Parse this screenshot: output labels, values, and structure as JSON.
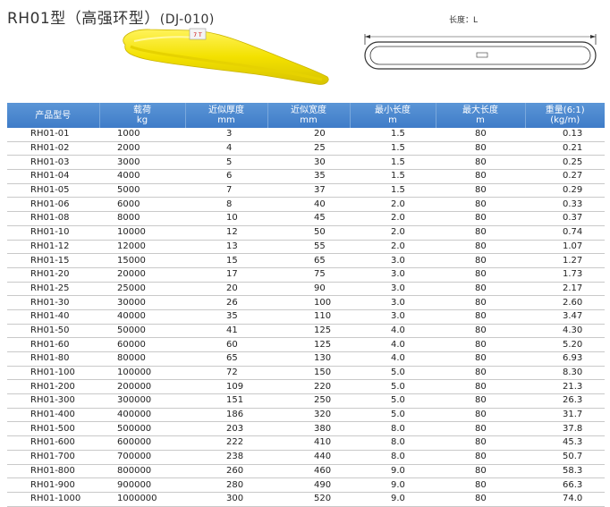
{
  "title": {
    "main": "RH01型（高强环型）",
    "code": "(DJ-010)"
  },
  "photo": {
    "tag_text": "7 T",
    "sling_color": "#f5e400"
  },
  "diagram": {
    "length_label": "长度：L"
  },
  "table": {
    "header_color": "#4a86cf",
    "headers": [
      {
        "l1": "产品型号",
        "l2": ""
      },
      {
        "l1": "载荷",
        "l2": "kg"
      },
      {
        "l1": "近似厚度",
        "l2": "mm"
      },
      {
        "l1": "近似宽度",
        "l2": "mm"
      },
      {
        "l1": "最小长度",
        "l2": "m"
      },
      {
        "l1": "最大长度",
        "l2": "m"
      },
      {
        "l1": "重量(6:1)",
        "l2": "(kg/m)"
      }
    ],
    "rows": [
      [
        "RH01-01",
        "1000",
        "3",
        "20",
        "1.5",
        "80",
        "0.13"
      ],
      [
        "RH01-02",
        "2000",
        "4",
        "25",
        "1.5",
        "80",
        "0.21"
      ],
      [
        "RH01-03",
        "3000",
        "5",
        "30",
        "1.5",
        "80",
        "0.25"
      ],
      [
        "RH01-04",
        "4000",
        "6",
        "35",
        "1.5",
        "80",
        "0.27"
      ],
      [
        "RH01-05",
        "5000",
        "7",
        "37",
        "1.5",
        "80",
        "0.29"
      ],
      [
        "RH01-06",
        "6000",
        "8",
        "40",
        "2.0",
        "80",
        "0.33"
      ],
      [
        "RH01-08",
        "8000",
        "10",
        "45",
        "2.0",
        "80",
        "0.37"
      ],
      [
        "RH01-10",
        "10000",
        "12",
        "50",
        "2.0",
        "80",
        "0.74"
      ],
      [
        "RH01-12",
        "12000",
        "13",
        "55",
        "2.0",
        "80",
        "1.07"
      ],
      [
        "RH01-15",
        "15000",
        "15",
        "65",
        "3.0",
        "80",
        "1.27"
      ],
      [
        "RH01-20",
        "20000",
        "17",
        "75",
        "3.0",
        "80",
        "1.73"
      ],
      [
        "RH01-25",
        "25000",
        "20",
        "90",
        "3.0",
        "80",
        "2.17"
      ],
      [
        "RH01-30",
        "30000",
        "26",
        "100",
        "3.0",
        "80",
        "2.60"
      ],
      [
        "RH01-40",
        "40000",
        "35",
        "110",
        "3.0",
        "80",
        "3.47"
      ],
      [
        "RH01-50",
        "50000",
        "41",
        "125",
        "4.0",
        "80",
        "4.30"
      ],
      [
        "RH01-60",
        "60000",
        "60",
        "125",
        "4.0",
        "80",
        "5.20"
      ],
      [
        "RH01-80",
        "80000",
        "65",
        "130",
        "4.0",
        "80",
        "6.93"
      ],
      [
        "RH01-100",
        "100000",
        "72",
        "150",
        "5.0",
        "80",
        "8.30"
      ],
      [
        "RH01-200",
        "200000",
        "109",
        "220",
        "5.0",
        "80",
        "21.3"
      ],
      [
        "RH01-300",
        "300000",
        "151",
        "250",
        "5.0",
        "80",
        "26.3"
      ],
      [
        "RH01-400",
        "400000",
        "186",
        "320",
        "5.0",
        "80",
        "31.7"
      ],
      [
        "RH01-500",
        "500000",
        "203",
        "380",
        "8.0",
        "80",
        "37.8"
      ],
      [
        "RH01-600",
        "600000",
        "222",
        "410",
        "8.0",
        "80",
        "45.3"
      ],
      [
        "RH01-700",
        "700000",
        "238",
        "440",
        "8.0",
        "80",
        "50.7"
      ],
      [
        "RH01-800",
        "800000",
        "260",
        "460",
        "9.0",
        "80",
        "58.3"
      ],
      [
        "RH01-900",
        "900000",
        "280",
        "490",
        "9.0",
        "80",
        "66.3"
      ],
      [
        "RH01-1000",
        "1000000",
        "300",
        "520",
        "9.0",
        "80",
        "74.0"
      ]
    ]
  }
}
